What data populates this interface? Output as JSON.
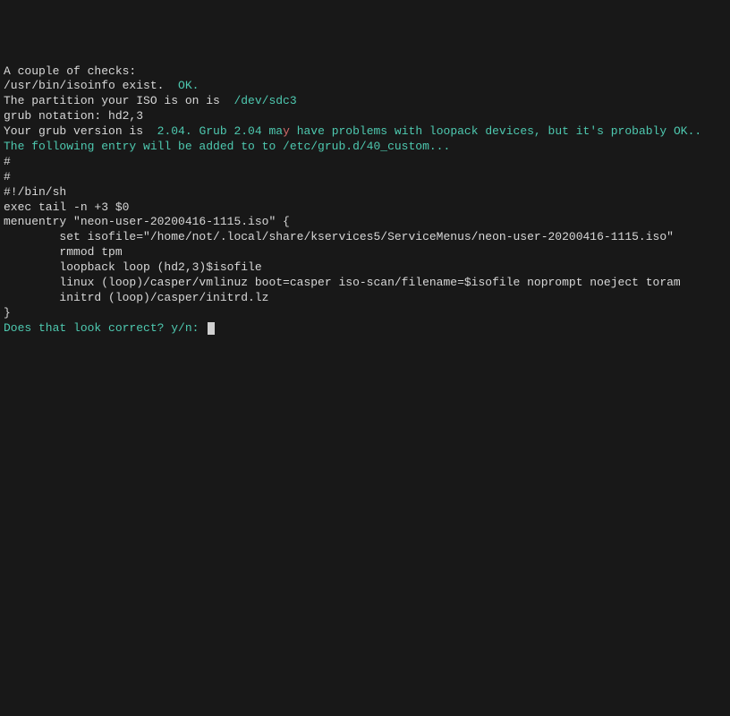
{
  "lines": {
    "l1": "A couple of checks:",
    "l2a": "/usr/bin/isoinfo exist.  ",
    "l2b": "OK.",
    "l3": "",
    "l4a": "The partition your ISO is on is  ",
    "l4b": "/dev/sdc3",
    "l5": "grub notation: hd2,3",
    "l6": "",
    "l7a": "Your grub version is  ",
    "l7b": "2.04. Grub 2.04 ma",
    "l7c": "y",
    "l7d": " have problems with loopack devices, but it's probably OK..",
    "l8": "",
    "l9": "The following entry will be added to to /etc/grub.d/40_custom...",
    "l10": "#",
    "l11": "#",
    "l12": "#!/bin/sh",
    "l13": "exec tail -n +3 $0",
    "l14": "menuentry \"neon-user-20200416-1115.iso\" {",
    "l15": "        set isofile=\"/home/not/.local/share/kservices5/ServiceMenus/neon-user-20200416-1115.iso\"",
    "l16": "        rmmod tpm",
    "l17": "        loopback loop (hd2,3)$isofile",
    "l18": "        linux (loop)/casper/vmlinuz boot=casper iso-scan/filename=$isofile noprompt noeject toram",
    "l19": "        initrd (loop)/casper/initrd.lz",
    "l20": "}",
    "l21": "Does that look correct? y/n: "
  }
}
